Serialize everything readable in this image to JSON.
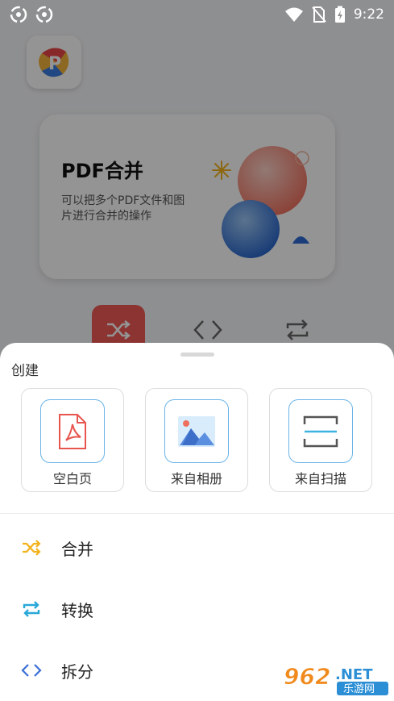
{
  "status_bar": {
    "time": "9:22",
    "icons": [
      "sync-icon",
      "sync-icon",
      "wifi-icon",
      "no-sim-icon",
      "battery-charging-icon"
    ]
  },
  "background": {
    "feature_card": {
      "title": "PDF合并",
      "description": "可以把多个PDF文件和图片进行合并的操作"
    },
    "tools": [
      "shuffle-icon",
      "code-brackets-icon",
      "repeat-icon"
    ]
  },
  "sheet": {
    "section_title": "创建",
    "create_options": [
      {
        "label": "空白页",
        "icon": "pdf-file-icon"
      },
      {
        "label": "来自相册",
        "icon": "image-icon"
      },
      {
        "label": "来自扫描",
        "icon": "scan-icon"
      }
    ],
    "menu": [
      {
        "label": "合并",
        "icon": "shuffle-icon",
        "color": "#f2b21c"
      },
      {
        "label": "转换",
        "icon": "repeat-icon",
        "color": "#29a8d8"
      },
      {
        "label": "拆分",
        "icon": "code-brackets-icon",
        "color": "#3b6fd6"
      }
    ]
  },
  "watermark": {
    "number": "962",
    "suffix": ".NET",
    "caption": "乐游网"
  },
  "colors": {
    "accent_red": "#f05a55",
    "scan_line": "#3fb3e0",
    "icon_border": "#6ab4e8"
  }
}
